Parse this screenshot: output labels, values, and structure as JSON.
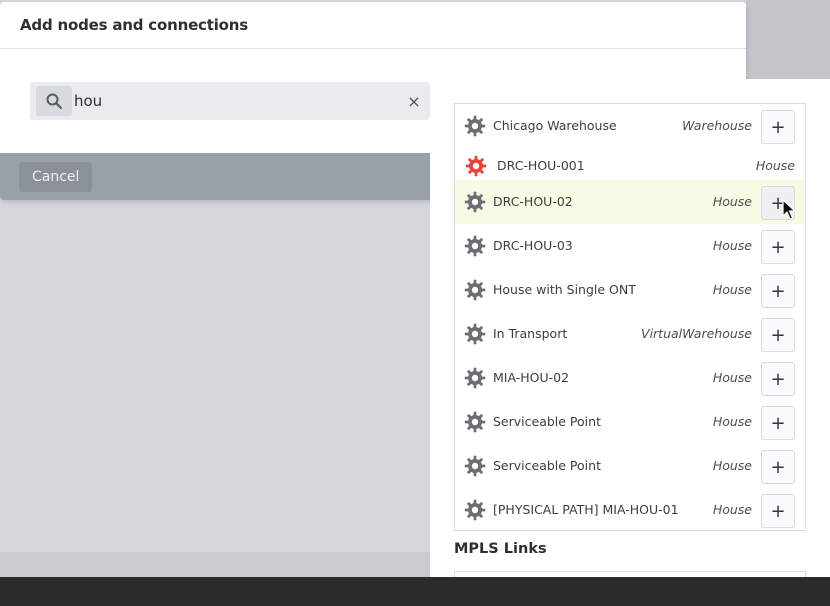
{
  "modal": {
    "title": "Add nodes and connections",
    "search": {
      "value": "hou",
      "placeholder": ""
    },
    "cancel_label": "Cancel"
  },
  "results": [
    {
      "name": "Chicago Warehouse",
      "type": "Warehouse",
      "icon": "gear-icon",
      "icon_color": "#6b6f74",
      "addable": true
    },
    {
      "name": "DRC-HOU-001",
      "type": "House",
      "icon": "gear-icon",
      "icon_color": "#e8453c",
      "addable": false
    },
    {
      "name": "DRC-HOU-02",
      "type": "House",
      "icon": "gear-icon",
      "icon_color": "#6b6f74",
      "addable": true,
      "hovered": true
    },
    {
      "name": "DRC-HOU-03",
      "type": "House",
      "icon": "gear-icon",
      "icon_color": "#6b6f74",
      "addable": true
    },
    {
      "name": "House with Single ONT",
      "type": "House",
      "icon": "gear-icon",
      "icon_color": "#6b6f74",
      "addable": true
    },
    {
      "name": "In Transport",
      "type": "VirtualWarehouse",
      "icon": "gear-icon",
      "icon_color": "#6b6f74",
      "addable": true
    },
    {
      "name": "MIA-HOU-02",
      "type": "House",
      "icon": "gear-icon",
      "icon_color": "#6b6f74",
      "addable": true
    },
    {
      "name": "Serviceable Point",
      "type": "House",
      "icon": "gear-icon",
      "icon_color": "#6b6f74",
      "addable": true
    },
    {
      "name": "Serviceable Point",
      "type": "House",
      "icon": "gear-icon",
      "icon_color": "#6b6f74",
      "addable": true
    },
    {
      "name": "[PHYSICAL PATH] MIA-HOU-01",
      "type": "House",
      "icon": "gear-icon",
      "icon_color": "#6b6f74",
      "addable": true
    }
  ],
  "add_symbol": "+",
  "clear_symbol": "×",
  "sections": {
    "mpls_title": "MPLS Links"
  },
  "colors": {
    "highlight_row": "#f7fbe4",
    "special_icon": "#e8453c",
    "footer": "#9aa0a7"
  }
}
